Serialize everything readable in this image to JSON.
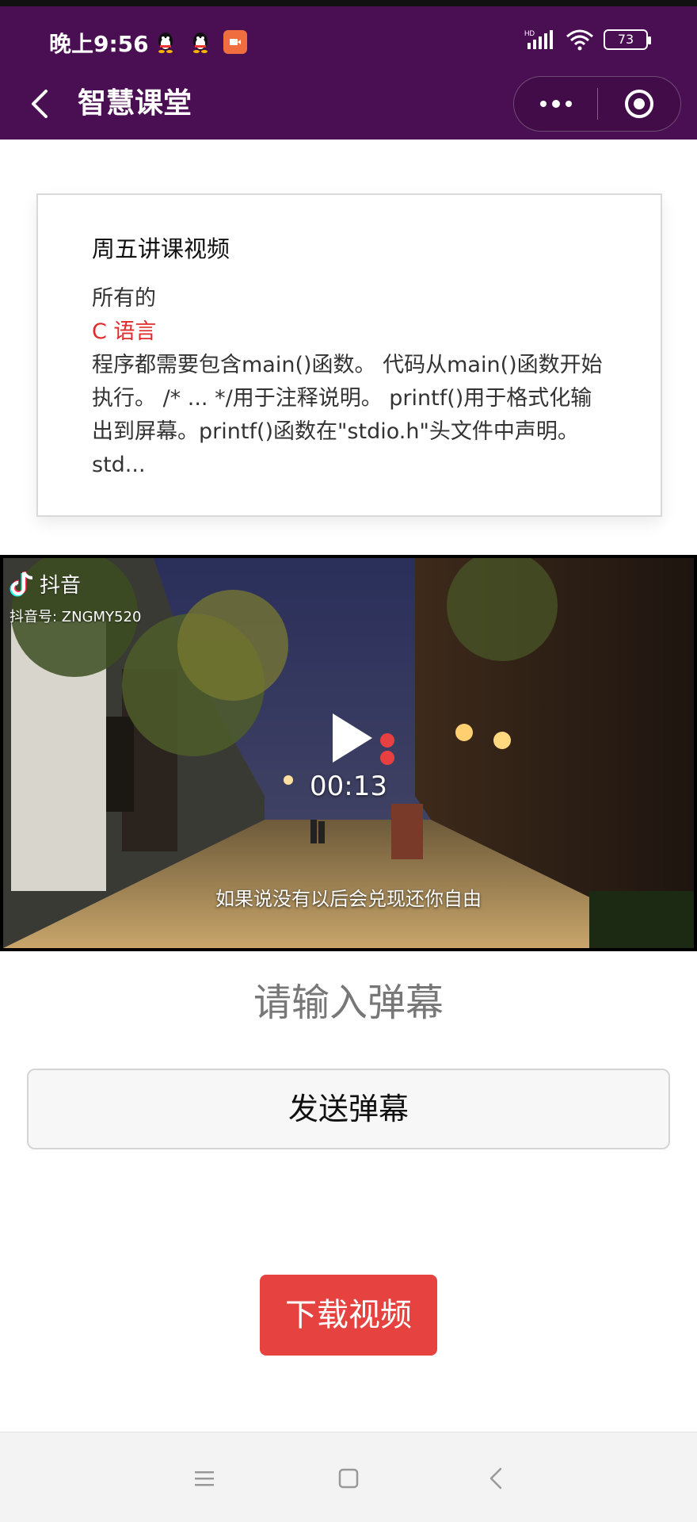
{
  "status_bar": {
    "time": "晚上9:56",
    "battery": "73",
    "icons": [
      "qq-icon",
      "qq-icon",
      "screen-record-icon",
      "hd-signal-icon",
      "wifi-icon",
      "battery-icon"
    ]
  },
  "header": {
    "title": "智慧课堂",
    "icons": [
      "back-icon",
      "more-dots-icon",
      "close-target-icon"
    ]
  },
  "lesson_card": {
    "title": "周五讲课视频",
    "line1": "所有的",
    "highlight": "C 语言",
    "body": "程序都需要包含main()函数。 代码从main()函数开始执行。 /* ... */用于注释说明。 printf()用于格式化输出到屏幕。printf()函数在\"stdio.h\"头文件中声明。 std..."
  },
  "video": {
    "platform": "抖音",
    "platform_id": "抖音号: ZNGMY520",
    "time": "00:13",
    "subtitle": "如果说没有以后会兑现还你自由"
  },
  "danmu": {
    "placeholder": "请输入弹幕",
    "send_label": "发送弹幕"
  },
  "download": {
    "label": "下载视频"
  },
  "colors": {
    "header_bg": "#4a0e52",
    "highlight": "#e02b2b",
    "download_bg": "#e64340"
  },
  "navbar": {
    "icons": [
      "menu-icon",
      "home-square-icon",
      "back-triangle-icon"
    ]
  }
}
